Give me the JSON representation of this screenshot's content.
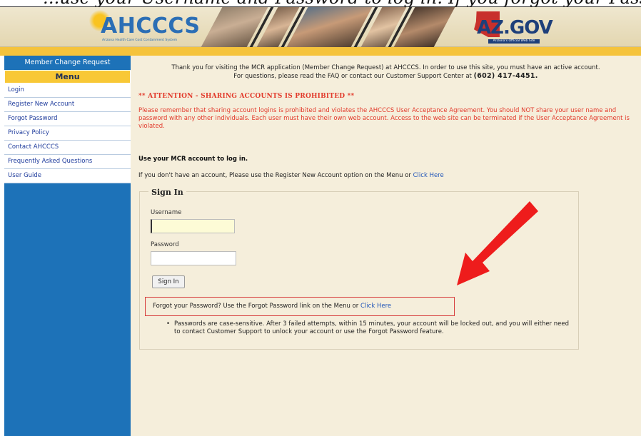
{
  "caption": {
    "text": "...use your Username and Password to log in. If you forgot your Password..."
  },
  "banner": {
    "logo_text": "AHCCCS",
    "logo_subtitle": "Arizona Health Care Cost Containment System",
    "azgov_text": "AZ.GOV",
    "azgov_subtitle": "Arizona's Official Web Site"
  },
  "sidebar": {
    "header": "Member Change Request",
    "menu_title": "Menu",
    "items": [
      {
        "label": "Login"
      },
      {
        "label": "Register New Account"
      },
      {
        "label": "Forgot Password"
      },
      {
        "label": "Privacy Policy"
      },
      {
        "label": "Contact AHCCCS"
      },
      {
        "label": "Frequently Asked Questions"
      },
      {
        "label": "User Guide"
      }
    ]
  },
  "main": {
    "intro_line1": "Thank you for visiting the MCR application (Member Change Request) at AHCCCS. In order to use this site, you must have an active account.",
    "intro_line2": "For questions, please read the FAQ or contact our Customer Support Center at",
    "phone": "(602) 417-4451.",
    "attention_title": "** ATTENTION - SHARING ACCOUNTS IS PROHIBITED **",
    "attention_body": "Please remember that sharing account logins is prohibited and violates the AHCCCS User Acceptance Agreement. You should NOT share your user name and password with any other individuals. Each user must have their own web account. Access to the web site can be terminated if the User Acceptance Agreement is violated.",
    "login_title": "Use your MCR account to log in.",
    "no_account_text": "If you don't have an account, Please use the Register New Account option on the Menu or",
    "no_account_link": "Click Here"
  },
  "signin": {
    "legend": "Sign In",
    "username_label": "Username",
    "username_value": "",
    "password_label": "Password",
    "password_value": "",
    "button_label": "Sign In",
    "forgot_text": "Forgot your Password? Use the Forgot Password link on the Menu or",
    "forgot_link": "Click Here",
    "note": "Passwords are case-sensitive. After 3 failed attempts, within 15 minutes, your account will be locked out, and you will either need to contact Customer Support to unlock your account or use the Forgot Password feature."
  },
  "colors": {
    "sidebar_blue": "#1d72b8",
    "gold": "#f5c33b",
    "warning_red": "#e23a2b",
    "arrow_red": "#ee1c1c",
    "link_blue": "#2256b9",
    "content_bg": "#f5eedb"
  },
  "icons": {
    "arrow": "red-diagonal-arrow-icon",
    "bullet": "bullet-icon"
  }
}
